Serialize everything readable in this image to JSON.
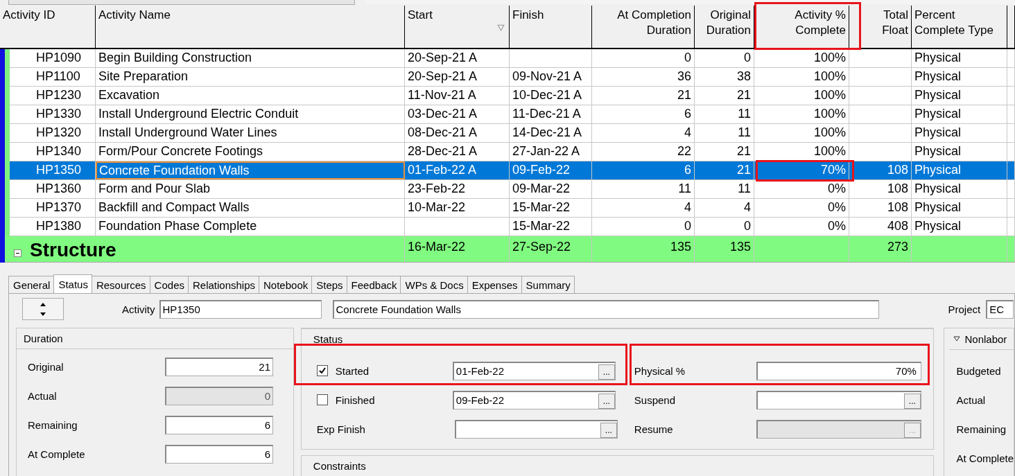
{
  "table": {
    "columns": [
      {
        "label": "Activity ID"
      },
      {
        "label": "Activity Name"
      },
      {
        "label": "Start",
        "sorted": true
      },
      {
        "label": "Finish"
      },
      {
        "label": "At Completion\nDuration"
      },
      {
        "label": "Original\nDuration"
      },
      {
        "label": "Activity %\nComplete"
      },
      {
        "label": "Total\nFloat"
      },
      {
        "label": "Percent\nComplete Type"
      }
    ],
    "rows": [
      {
        "cells": [
          "HP1090",
          "Begin Building Construction",
          "20-Sep-21 A",
          "",
          "0",
          "0",
          "100%",
          "",
          "Physical"
        ],
        "selected": false
      },
      {
        "cells": [
          "HP1100",
          "Site Preparation",
          "20-Sep-21 A",
          "09-Nov-21 A",
          "36",
          "38",
          "100%",
          "",
          "Physical"
        ],
        "selected": false
      },
      {
        "cells": [
          "HP1230",
          "Excavation",
          "11-Nov-21 A",
          "10-Dec-21 A",
          "21",
          "21",
          "100%",
          "",
          "Physical"
        ],
        "selected": false
      },
      {
        "cells": [
          "HP1330",
          "Install Underground Electric Conduit",
          "03-Dec-21 A",
          "11-Dec-21 A",
          "6",
          "11",
          "100%",
          "",
          "Physical"
        ],
        "selected": false
      },
      {
        "cells": [
          "HP1320",
          "Install Underground Water Lines",
          "08-Dec-21 A",
          "14-Dec-21 A",
          "4",
          "11",
          "100%",
          "",
          "Physical"
        ],
        "selected": false
      },
      {
        "cells": [
          "HP1340",
          "Form/Pour Concrete Footings",
          "28-Dec-21 A",
          "27-Jan-22 A",
          "22",
          "21",
          "100%",
          "",
          "Physical"
        ],
        "selected": false
      },
      {
        "cells": [
          "HP1350",
          "Concrete Foundation Walls",
          "01-Feb-22 A",
          "09-Feb-22",
          "6",
          "21",
          "70%",
          "108",
          "Physical"
        ],
        "selected": true
      },
      {
        "cells": [
          "HP1360",
          "Form and Pour Slab",
          "23-Feb-22",
          "09-Mar-22",
          "11",
          "11",
          "0%",
          "108",
          "Physical"
        ],
        "selected": false
      },
      {
        "cells": [
          "HP1370",
          "Backfill and Compact Walls",
          "10-Mar-22",
          "15-Mar-22",
          "4",
          "4",
          "0%",
          "108",
          "Physical"
        ],
        "selected": false
      },
      {
        "cells": [
          "HP1380",
          "Foundation Phase Complete",
          "",
          "15-Mar-22",
          "0",
          "0",
          "0%",
          "408",
          "Physical"
        ],
        "selected": false
      }
    ],
    "group": {
      "name": "Structure",
      "cells": [
        "16-Mar-22",
        "27-Sep-22",
        "135",
        "135",
        "",
        "273",
        ""
      ]
    }
  },
  "details": {
    "tabs": [
      {
        "label": "General",
        "selected": false
      },
      {
        "label": "Status",
        "selected": true
      },
      {
        "label": "Resources",
        "selected": false
      },
      {
        "label": "Codes",
        "selected": false
      },
      {
        "label": "Relationships",
        "selected": false
      },
      {
        "label": "Notebook",
        "selected": false
      },
      {
        "label": "Steps",
        "selected": false
      },
      {
        "label": "Feedback",
        "selected": false
      },
      {
        "label": "WPs & Docs",
        "selected": false
      },
      {
        "label": "Expenses",
        "selected": false
      },
      {
        "label": "Summary",
        "selected": false
      }
    ],
    "activity_label": "Activity",
    "activity_id": "HP1350",
    "activity_name": "Concrete Foundation Walls",
    "project_label": "Project",
    "project_value": "EC",
    "duration": {
      "title": "Duration",
      "fields": [
        {
          "label": "Original",
          "value": "21",
          "disabled": false
        },
        {
          "label": "Actual",
          "value": "0",
          "disabled": true
        },
        {
          "label": "Remaining",
          "value": "6",
          "disabled": false
        },
        {
          "label": "At Complete",
          "value": "6",
          "disabled": false
        }
      ]
    },
    "status": {
      "title": "Status",
      "left": [
        {
          "kind": "check",
          "label": "Started",
          "checked": true,
          "value": "01-Feb-22",
          "button": "...",
          "disabled": false
        },
        {
          "kind": "check",
          "label": "Finished",
          "checked": false,
          "value": "09-Feb-22",
          "button": "...",
          "disabled": false
        },
        {
          "kind": "plain",
          "label": "Exp Finish",
          "button": "...",
          "disabled": false
        }
      ],
      "right": [
        {
          "kind": "plain",
          "label": "Physical %",
          "value": "70%",
          "disabled": false
        },
        {
          "kind": "plain",
          "label": "Suspend",
          "button": "...",
          "disabled": false
        },
        {
          "kind": "plain",
          "label": "Resume",
          "button": "...",
          "disabled": true
        }
      ]
    },
    "constraints": {
      "title": "Constraints"
    },
    "nonlabor": {
      "title": "Nonlabor",
      "labels": [
        "Budgeted",
        "Actual",
        "Remaining",
        "At Complete"
      ]
    }
  }
}
